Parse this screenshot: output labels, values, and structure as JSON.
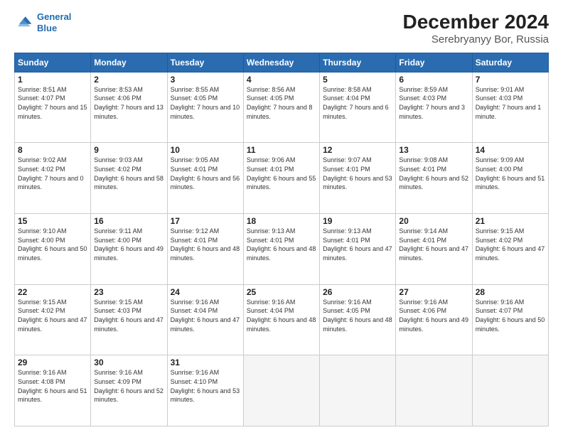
{
  "header": {
    "logo_line1": "General",
    "logo_line2": "Blue",
    "month": "December 2024",
    "location": "Serebryanyy Bor, Russia"
  },
  "weekdays": [
    "Sunday",
    "Monday",
    "Tuesday",
    "Wednesday",
    "Thursday",
    "Friday",
    "Saturday"
  ],
  "weeks": [
    [
      {
        "day": "1",
        "sunrise": "Sunrise: 8:51 AM",
        "sunset": "Sunset: 4:07 PM",
        "daylight": "Daylight: 7 hours and 15 minutes."
      },
      {
        "day": "2",
        "sunrise": "Sunrise: 8:53 AM",
        "sunset": "Sunset: 4:06 PM",
        "daylight": "Daylight: 7 hours and 13 minutes."
      },
      {
        "day": "3",
        "sunrise": "Sunrise: 8:55 AM",
        "sunset": "Sunset: 4:05 PM",
        "daylight": "Daylight: 7 hours and 10 minutes."
      },
      {
        "day": "4",
        "sunrise": "Sunrise: 8:56 AM",
        "sunset": "Sunset: 4:05 PM",
        "daylight": "Daylight: 7 hours and 8 minutes."
      },
      {
        "day": "5",
        "sunrise": "Sunrise: 8:58 AM",
        "sunset": "Sunset: 4:04 PM",
        "daylight": "Daylight: 7 hours and 6 minutes."
      },
      {
        "day": "6",
        "sunrise": "Sunrise: 8:59 AM",
        "sunset": "Sunset: 4:03 PM",
        "daylight": "Daylight: 7 hours and 3 minutes."
      },
      {
        "day": "7",
        "sunrise": "Sunrise: 9:01 AM",
        "sunset": "Sunset: 4:03 PM",
        "daylight": "Daylight: 7 hours and 1 minute."
      }
    ],
    [
      {
        "day": "8",
        "sunrise": "Sunrise: 9:02 AM",
        "sunset": "Sunset: 4:02 PM",
        "daylight": "Daylight: 7 hours and 0 minutes."
      },
      {
        "day": "9",
        "sunrise": "Sunrise: 9:03 AM",
        "sunset": "Sunset: 4:02 PM",
        "daylight": "Daylight: 6 hours and 58 minutes."
      },
      {
        "day": "10",
        "sunrise": "Sunrise: 9:05 AM",
        "sunset": "Sunset: 4:01 PM",
        "daylight": "Daylight: 6 hours and 56 minutes."
      },
      {
        "day": "11",
        "sunrise": "Sunrise: 9:06 AM",
        "sunset": "Sunset: 4:01 PM",
        "daylight": "Daylight: 6 hours and 55 minutes."
      },
      {
        "day": "12",
        "sunrise": "Sunrise: 9:07 AM",
        "sunset": "Sunset: 4:01 PM",
        "daylight": "Daylight: 6 hours and 53 minutes."
      },
      {
        "day": "13",
        "sunrise": "Sunrise: 9:08 AM",
        "sunset": "Sunset: 4:01 PM",
        "daylight": "Daylight: 6 hours and 52 minutes."
      },
      {
        "day": "14",
        "sunrise": "Sunrise: 9:09 AM",
        "sunset": "Sunset: 4:00 PM",
        "daylight": "Daylight: 6 hours and 51 minutes."
      }
    ],
    [
      {
        "day": "15",
        "sunrise": "Sunrise: 9:10 AM",
        "sunset": "Sunset: 4:00 PM",
        "daylight": "Daylight: 6 hours and 50 minutes."
      },
      {
        "day": "16",
        "sunrise": "Sunrise: 9:11 AM",
        "sunset": "Sunset: 4:00 PM",
        "daylight": "Daylight: 6 hours and 49 minutes."
      },
      {
        "day": "17",
        "sunrise": "Sunrise: 9:12 AM",
        "sunset": "Sunset: 4:01 PM",
        "daylight": "Daylight: 6 hours and 48 minutes."
      },
      {
        "day": "18",
        "sunrise": "Sunrise: 9:13 AM",
        "sunset": "Sunset: 4:01 PM",
        "daylight": "Daylight: 6 hours and 48 minutes."
      },
      {
        "day": "19",
        "sunrise": "Sunrise: 9:13 AM",
        "sunset": "Sunset: 4:01 PM",
        "daylight": "Daylight: 6 hours and 47 minutes."
      },
      {
        "day": "20",
        "sunrise": "Sunrise: 9:14 AM",
        "sunset": "Sunset: 4:01 PM",
        "daylight": "Daylight: 6 hours and 47 minutes."
      },
      {
        "day": "21",
        "sunrise": "Sunrise: 9:15 AM",
        "sunset": "Sunset: 4:02 PM",
        "daylight": "Daylight: 6 hours and 47 minutes."
      }
    ],
    [
      {
        "day": "22",
        "sunrise": "Sunrise: 9:15 AM",
        "sunset": "Sunset: 4:02 PM",
        "daylight": "Daylight: 6 hours and 47 minutes."
      },
      {
        "day": "23",
        "sunrise": "Sunrise: 9:15 AM",
        "sunset": "Sunset: 4:03 PM",
        "daylight": "Daylight: 6 hours and 47 minutes."
      },
      {
        "day": "24",
        "sunrise": "Sunrise: 9:16 AM",
        "sunset": "Sunset: 4:04 PM",
        "daylight": "Daylight: 6 hours and 47 minutes."
      },
      {
        "day": "25",
        "sunrise": "Sunrise: 9:16 AM",
        "sunset": "Sunset: 4:04 PM",
        "daylight": "Daylight: 6 hours and 48 minutes."
      },
      {
        "day": "26",
        "sunrise": "Sunrise: 9:16 AM",
        "sunset": "Sunset: 4:05 PM",
        "daylight": "Daylight: 6 hours and 48 minutes."
      },
      {
        "day": "27",
        "sunrise": "Sunrise: 9:16 AM",
        "sunset": "Sunset: 4:06 PM",
        "daylight": "Daylight: 6 hours and 49 minutes."
      },
      {
        "day": "28",
        "sunrise": "Sunrise: 9:16 AM",
        "sunset": "Sunset: 4:07 PM",
        "daylight": "Daylight: 6 hours and 50 minutes."
      }
    ],
    [
      {
        "day": "29",
        "sunrise": "Sunrise: 9:16 AM",
        "sunset": "Sunset: 4:08 PM",
        "daylight": "Daylight: 6 hours and 51 minutes."
      },
      {
        "day": "30",
        "sunrise": "Sunrise: 9:16 AM",
        "sunset": "Sunset: 4:09 PM",
        "daylight": "Daylight: 6 hours and 52 minutes."
      },
      {
        "day": "31",
        "sunrise": "Sunrise: 9:16 AM",
        "sunset": "Sunset: 4:10 PM",
        "daylight": "Daylight: 6 hours and 53 minutes."
      },
      null,
      null,
      null,
      null
    ]
  ]
}
